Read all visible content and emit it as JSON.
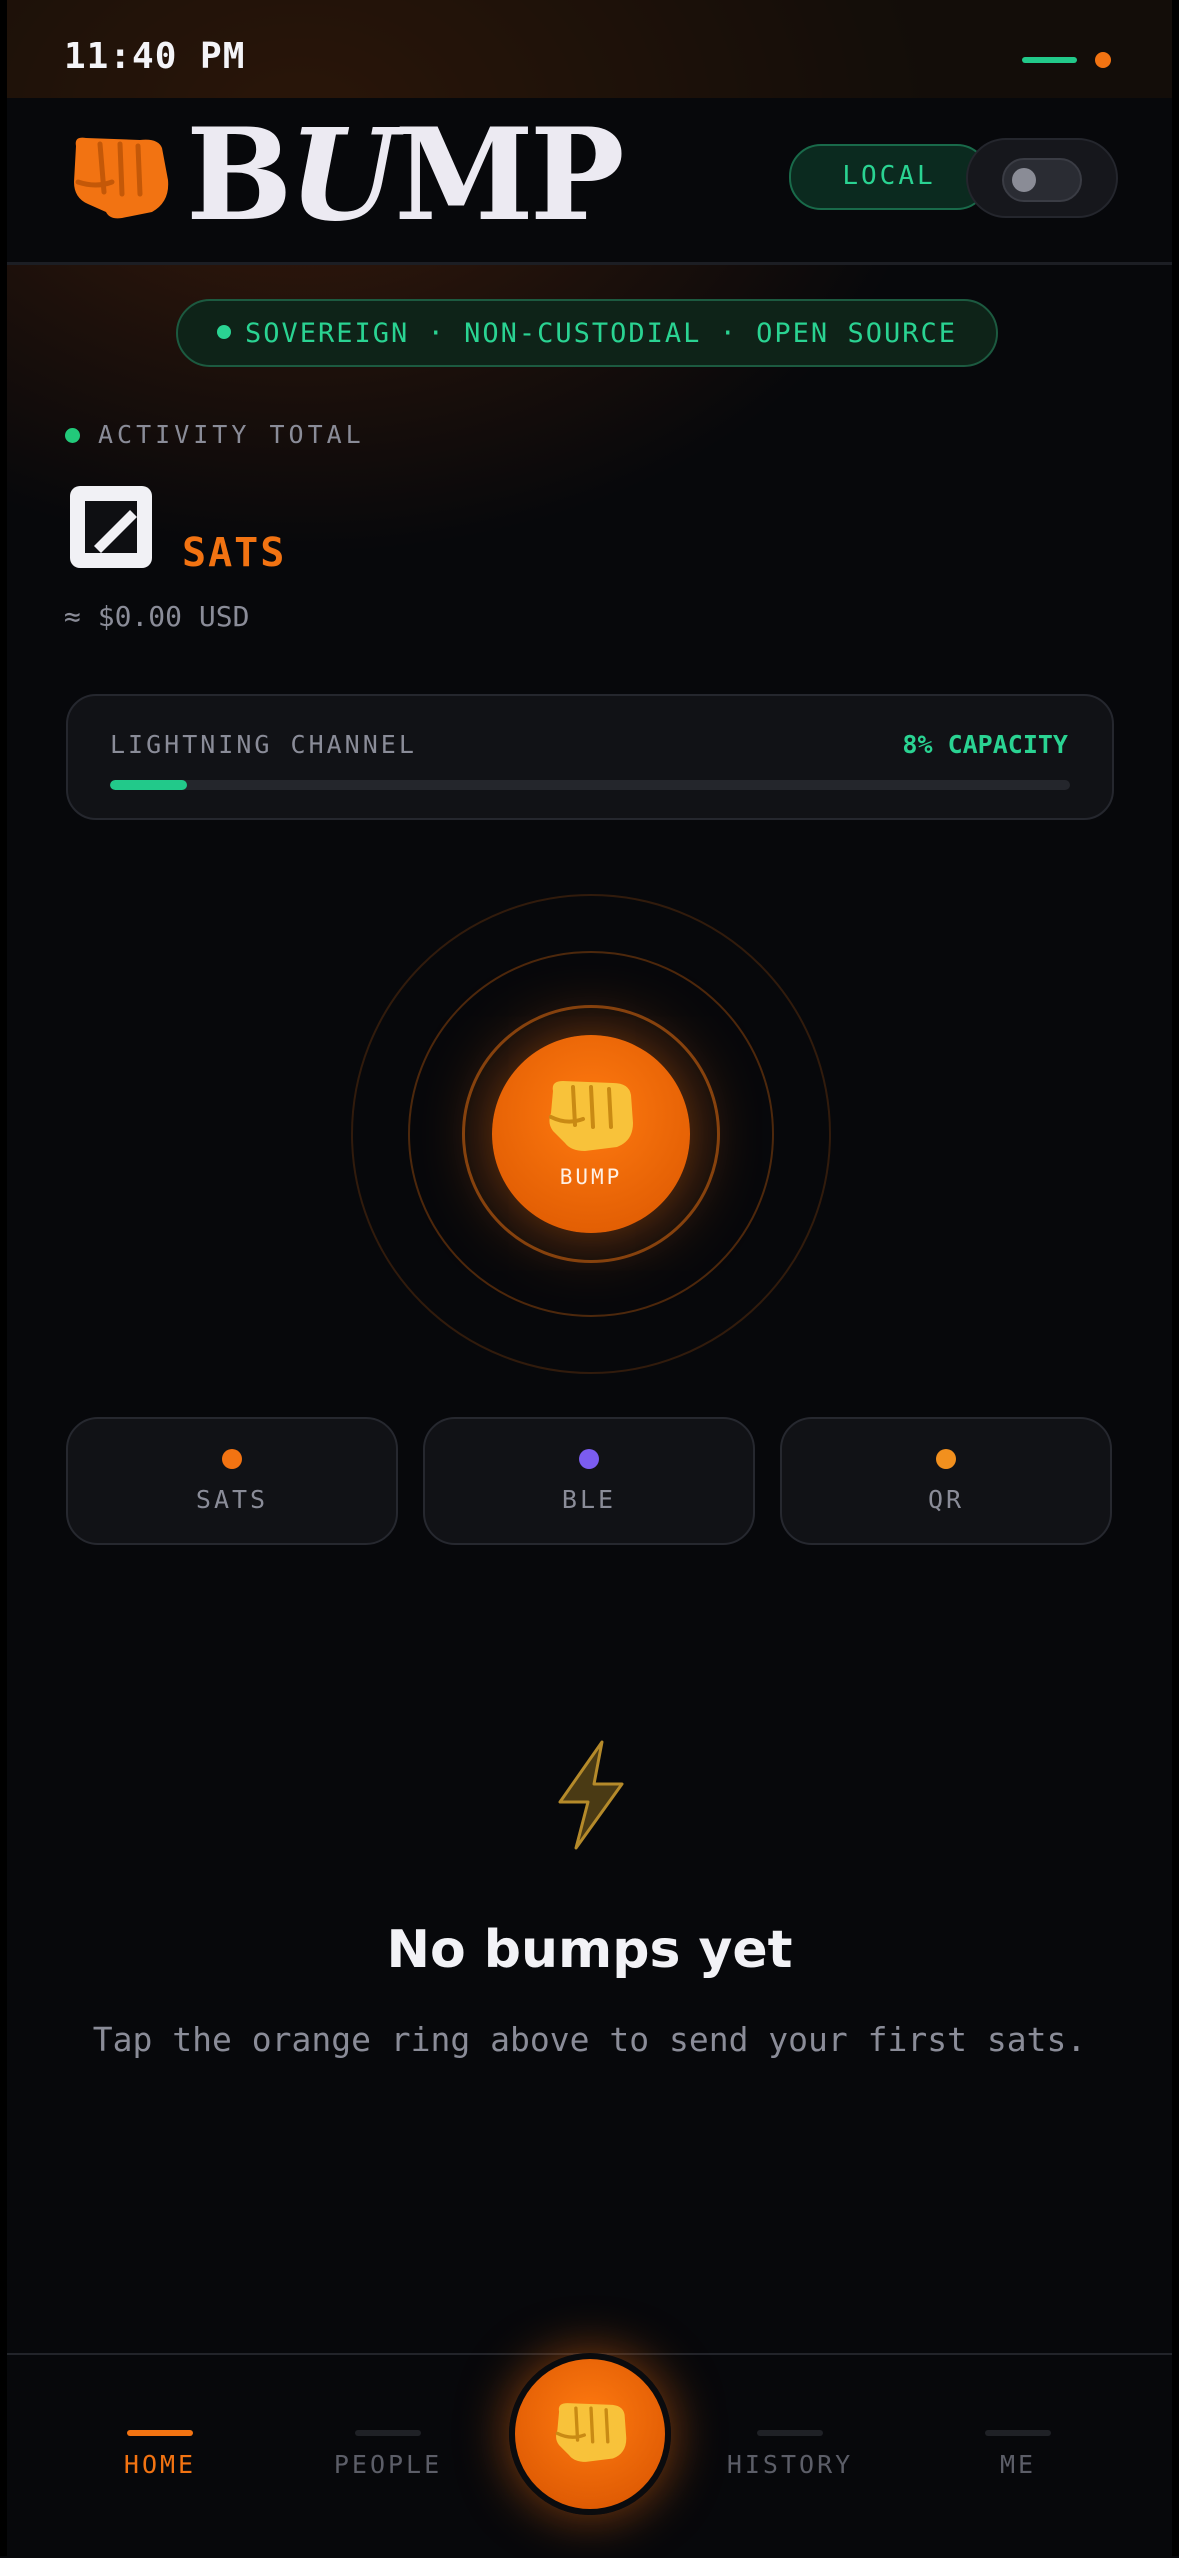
{
  "status_bar": {
    "time": "11:40 PM"
  },
  "header": {
    "logo_text_1": "B",
    "logo_text_2": "U",
    "logo_text_3": "MP",
    "local_label": "LOCAL"
  },
  "tagline": "SOVEREIGN · NON-CUSTODIAL · OPEN SOURCE",
  "activity": {
    "label": "ACTIVITY TOTAL",
    "unit": "SATS",
    "usd": "≈ $0.00 USD"
  },
  "channel": {
    "label": "LIGHTNING CHANNEL",
    "capacity_label": "8% CAPACITY",
    "capacity_fraction": 0.08
  },
  "bump": {
    "label": "BUMP"
  },
  "modes": [
    {
      "label": "SATS",
      "color": "#f27312"
    },
    {
      "label": "BLE",
      "color": "#7b5cf0"
    },
    {
      "label": "QR",
      "color": "#f2901e"
    }
  ],
  "empty_state": {
    "icon": "lightning-bolt-icon",
    "title": "No bumps yet",
    "subtitle": "Tap the orange ring above to send your first sats."
  },
  "nav": {
    "home": "HOME",
    "people": "PEOPLE",
    "history": "HISTORY",
    "me": "ME"
  },
  "colors": {
    "accent": "#f27312",
    "success": "#22c98a",
    "background": "#07080b"
  }
}
